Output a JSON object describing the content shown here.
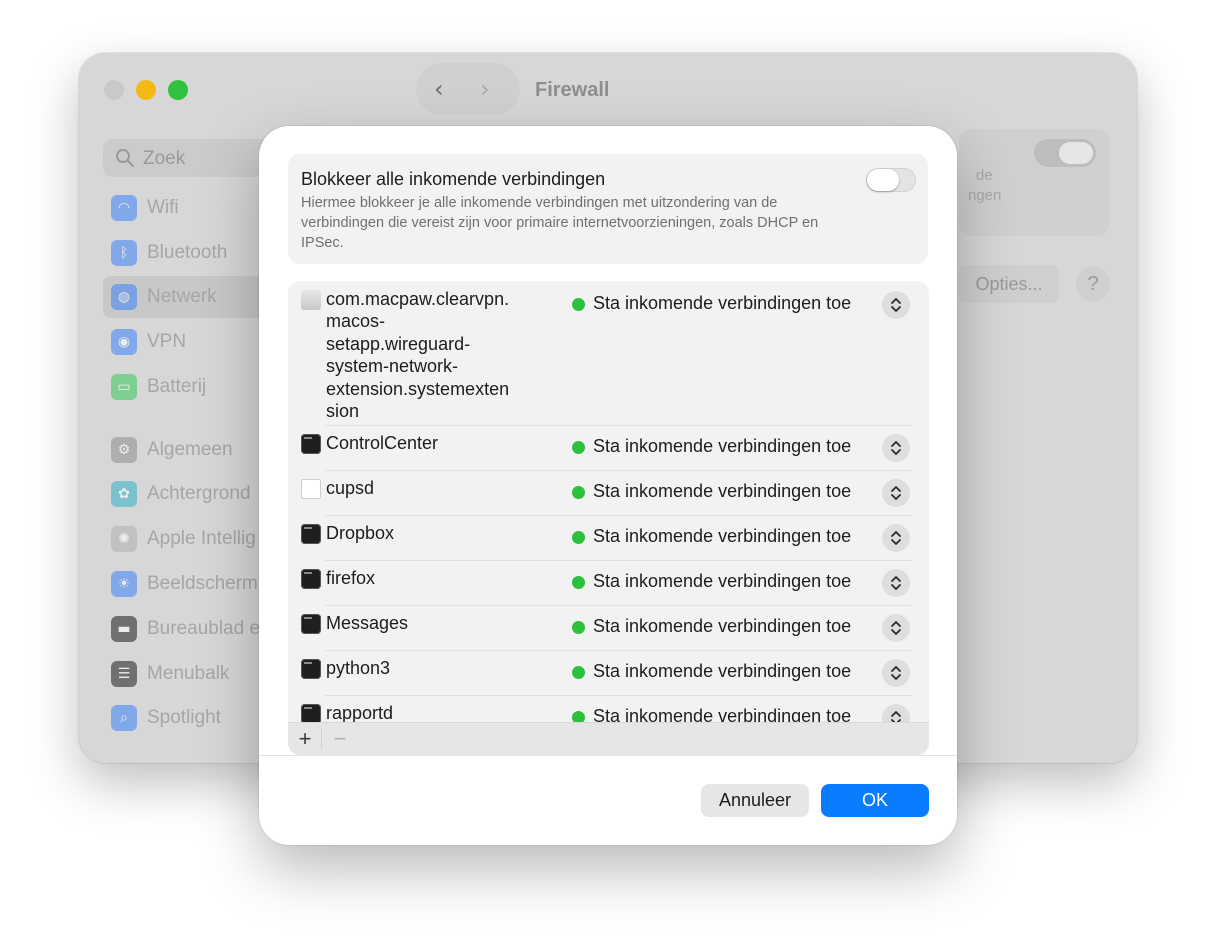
{
  "window": {
    "title": "Firewall",
    "nav_back": "‹",
    "nav_forward": "›"
  },
  "search": {
    "placeholder": "Zoek"
  },
  "sidebar": {
    "items": [
      {
        "label": "Wifi",
        "icon": "wifi-icon",
        "color": "#3b82f6",
        "glyph": "◠"
      },
      {
        "label": "Bluetooth",
        "icon": "bluetooth-icon",
        "color": "#3b82f6",
        "glyph": "ᛒ"
      },
      {
        "label": "Netwerk",
        "icon": "globe-icon",
        "color": "#3b82f6",
        "glyph": "◍"
      },
      {
        "label": "VPN",
        "icon": "vpn-icon",
        "color": "#3b82f6",
        "glyph": "◉"
      },
      {
        "label": "Batterij",
        "icon": "battery-icon",
        "color": "#34c759",
        "glyph": "▭"
      },
      {
        "label": "Algemeen",
        "icon": "gear-icon",
        "color": "#8e8e93",
        "glyph": "⚙"
      },
      {
        "label": "Achtergrond",
        "icon": "wallpaper-icon",
        "color": "#30b0c7",
        "glyph": "✿"
      },
      {
        "label": "Apple Intellig",
        "icon": "apple-intelligence-icon",
        "color": "#b0b0b0",
        "glyph": "✺"
      },
      {
        "label": "Beeldscherm",
        "icon": "display-icon",
        "color": "#3b82f6",
        "glyph": "☀"
      },
      {
        "label": "Bureaublad e",
        "icon": "desktop-icon",
        "color": "#1c1c1e",
        "glyph": "▬"
      },
      {
        "label": "Menubalk",
        "icon": "menubar-icon",
        "color": "#1c1c1e",
        "glyph": "☰"
      },
      {
        "label": "Spotlight",
        "icon": "spotlight-icon",
        "color": "#3b82f6",
        "glyph": "⌕"
      }
    ],
    "active_index": 2
  },
  "background_card": {
    "line1": "de",
    "line2": "ngen",
    "options_label": "Opties...",
    "help_label": "?"
  },
  "dialog": {
    "block_title": "Blokkeer alle inkomende verbindingen",
    "block_description": "Hiermee blokkeer je alle inkomende verbindingen met uitzondering van de verbindingen die vereist zijn voor primaire internetvoorzieningen, zoals DHCP en IPSec.",
    "block_enabled": false,
    "apps": [
      {
        "name": "com.macpaw.clearvpn.\nmacos-\nsetapp.wireguard-\nsystem-network-\nextension.systemexten\nsion",
        "icon": "extension-icon",
        "kind": "ext",
        "status": "Sta inkomende verbindingen toe",
        "status_color": "#2dbf3e"
      },
      {
        "name": "ControlCenter",
        "icon": "app-icon",
        "kind": "term",
        "status": "Sta inkomende verbindingen toe",
        "status_color": "#2dbf3e"
      },
      {
        "name": "cupsd",
        "icon": "document-icon",
        "kind": "doc",
        "status": "Sta inkomende verbindingen toe",
        "status_color": "#2dbf3e"
      },
      {
        "name": "Dropbox",
        "icon": "app-icon",
        "kind": "term",
        "status": "Sta inkomende verbindingen toe",
        "status_color": "#2dbf3e"
      },
      {
        "name": "firefox",
        "icon": "app-icon",
        "kind": "term",
        "status": "Sta inkomende verbindingen toe",
        "status_color": "#2dbf3e"
      },
      {
        "name": "Messages",
        "icon": "app-icon",
        "kind": "term",
        "status": "Sta inkomende verbindingen toe",
        "status_color": "#2dbf3e"
      },
      {
        "name": "python3",
        "icon": "app-icon",
        "kind": "term",
        "status": "Sta inkomende verbindingen toe",
        "status_color": "#2dbf3e"
      },
      {
        "name": "rapportd",
        "icon": "app-icon",
        "kind": "term",
        "status": "Sta inkomende verbindingen toe",
        "status_color": "#2dbf3e"
      }
    ],
    "add_label": "+",
    "remove_label": "−",
    "cancel_label": "Annuleer",
    "ok_label": "OK",
    "accent_color": "#0a7cff"
  }
}
